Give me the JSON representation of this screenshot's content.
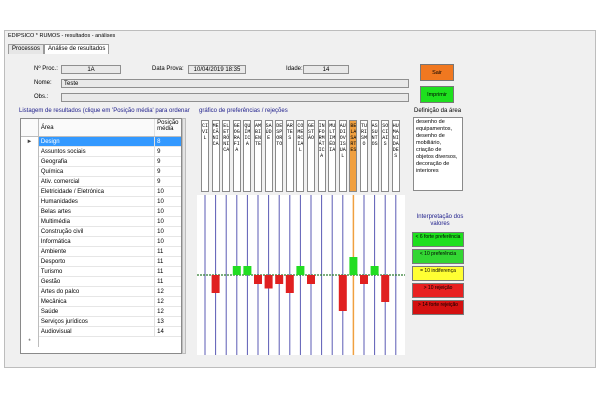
{
  "title": "EDIPSICO * RUMOS - resultados - análises",
  "tabs": [
    {
      "label": "Processos",
      "active": false
    },
    {
      "label": "Análise de resultados",
      "active": true
    }
  ],
  "form": {
    "nproc_label": "Nº Proc.:",
    "nproc": "1A",
    "data_label": "Data Prova:",
    "data": "10/04/2019 18:35",
    "idade_label": "Idade:",
    "idade": "14",
    "nome_label": "Nome:",
    "nome": "Teste",
    "obs_label": "Obs.:",
    "obs": ""
  },
  "buttons": {
    "sair": "Sair",
    "imprimir": "Imprimir",
    "sair_color": "#f07820",
    "imprimir_color": "#1ee01e"
  },
  "list": {
    "heading": "Listagem de resultados (clique em 'Posição média' para ordenar",
    "col_area": "Área",
    "col_pos": "Posição média",
    "rows": [
      {
        "area": "Design",
        "pos": "8"
      },
      {
        "area": "Assuntos sociais",
        "pos": "9"
      },
      {
        "area": "Geografia",
        "pos": "9"
      },
      {
        "area": "Química",
        "pos": "9"
      },
      {
        "area": "Ativ. comercial",
        "pos": "9"
      },
      {
        "area": "Eletricidade / Eletrónica",
        "pos": "10"
      },
      {
        "area": "Humanidades",
        "pos": "10"
      },
      {
        "area": "Belas artes",
        "pos": "10"
      },
      {
        "area": "Multimédia",
        "pos": "10"
      },
      {
        "area": "Construção civil",
        "pos": "10"
      },
      {
        "area": "Informática",
        "pos": "10"
      },
      {
        "area": "Ambiente",
        "pos": "11"
      },
      {
        "area": "Desporto",
        "pos": "11"
      },
      {
        "area": "Turismo",
        "pos": "11"
      },
      {
        "area": "Gestão",
        "pos": "11"
      },
      {
        "area": "Artes do palco",
        "pos": "12"
      },
      {
        "area": "Mecânica",
        "pos": "12"
      },
      {
        "area": "Saúde",
        "pos": "12"
      },
      {
        "area": "Serviços jurídicos",
        "pos": "13"
      },
      {
        "area": "Audiovisual",
        "pos": "14"
      }
    ],
    "selected_row_indicator": "►",
    "new_row_indicator": "*"
  },
  "chart_heading": "gráfico de preferências / rejeções",
  "categories": [
    {
      "label": "CIVIL",
      "highlight": false
    },
    {
      "label": "MECÂNICA",
      "highlight": false
    },
    {
      "label": "ELETRÓNICA",
      "highlight": false
    },
    {
      "label": "GEOGRAFIA",
      "highlight": false
    },
    {
      "label": "QUÍMICA",
      "highlight": false
    },
    {
      "label": "AMBIENTE",
      "highlight": false
    },
    {
      "label": "SAÚDE",
      "highlight": false
    },
    {
      "label": "DESPORTO",
      "highlight": false
    },
    {
      "label": "ARTES",
      "highlight": false
    },
    {
      "label": "COMERCIAL",
      "highlight": false
    },
    {
      "label": "GESTÃO",
      "highlight": false
    },
    {
      "label": "INFORMÁTICA",
      "highlight": false
    },
    {
      "label": "MULTIMÉDIA",
      "highlight": false
    },
    {
      "label": "AUDIOVISUAL",
      "highlight": false
    },
    {
      "label": "BELASARTES",
      "highlight": true
    },
    {
      "label": "TURISMO",
      "highlight": false
    },
    {
      "label": "ASSUNTOS",
      "highlight": false
    },
    {
      "label": "SOCIAIS",
      "highlight": false
    },
    {
      "label": "HUMANIDADES",
      "highlight": false
    }
  ],
  "chart_data": {
    "type": "bar",
    "baseline": 0,
    "values": [
      0,
      -2,
      0,
      1,
      1,
      -1,
      -1.5,
      -1,
      -2,
      1,
      -1,
      0,
      0,
      -4,
      2,
      -1,
      1,
      -3,
      0
    ],
    "colors": {
      "positive": "#22dd22",
      "negative": "#e02020",
      "axis": "#5b5bb5",
      "baseline": "#2e7d32"
    }
  },
  "definition": {
    "heading": "Definição da área",
    "text": "desenho de equipamentos, desenho de mobiliário, criação de objetos diversos, decoração de interiores"
  },
  "legend": {
    "heading": "Interpretação dos valores",
    "items": [
      {
        "label": "< 6 forte preferência",
        "color": "#1ee01e"
      },
      {
        "label": "< 10 preferência",
        "color": "#33d633"
      },
      {
        "label": "= 10 indiferença",
        "color": "#ffff33"
      },
      {
        "label": "> 10 rejeição",
        "color": "#e82020"
      },
      {
        "label": "> 14 forte rejeição",
        "color": "#d41010"
      }
    ]
  }
}
